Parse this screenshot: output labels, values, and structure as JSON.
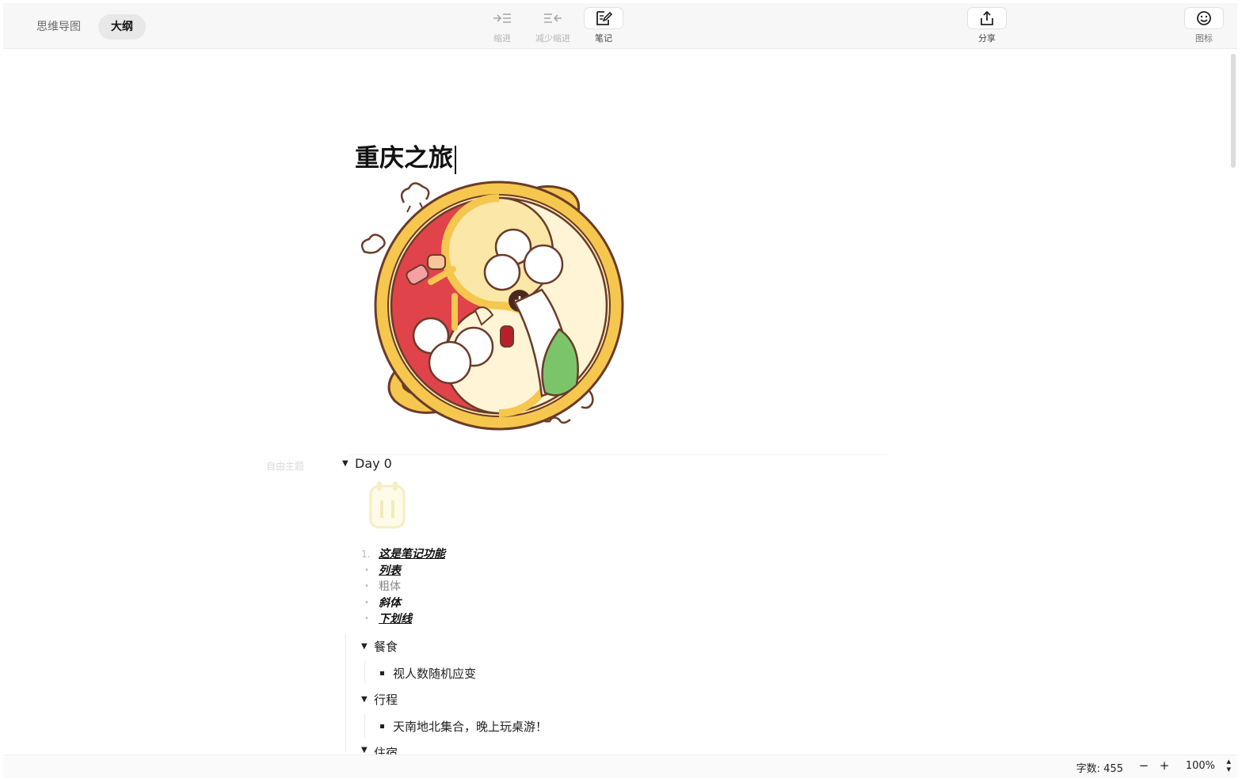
{
  "view": {
    "mindmap_label": "思维导图",
    "outline_label": "大纲"
  },
  "toolbar": {
    "indent": {
      "label": "缩进",
      "icon": "indent-icon"
    },
    "outdent": {
      "label": "减少缩进",
      "icon": "outdent-icon"
    },
    "notes": {
      "label": "笔记",
      "icon": "note-edit-icon"
    },
    "share": {
      "label": "分享",
      "icon": "share-icon"
    },
    "icon": {
      "label": "图标",
      "icon": "emoji-icon"
    }
  },
  "document": {
    "title": "重庆之旅",
    "free_topic_label": "自由主题",
    "day0": {
      "label": "Day 0",
      "note": {
        "items": [
          {
            "marker": "1.",
            "text": "这是笔记功能"
          },
          {
            "marker": "•",
            "text": "列表"
          },
          {
            "marker": "•",
            "text": "粗体"
          },
          {
            "marker": "•",
            "text": "斜体"
          },
          {
            "marker": "•",
            "text": "下划线"
          }
        ]
      },
      "children": [
        {
          "label": "餐食",
          "children": [
            "视人数随机应变"
          ]
        },
        {
          "label": "行程",
          "children": [
            "天南地北集合，晚上玩桌游！"
          ]
        },
        {
          "label": "住宿"
        }
      ]
    }
  },
  "status": {
    "word_count": "字数: 455",
    "zoom": "100%",
    "zoom_out": "−",
    "zoom_in": "+"
  },
  "colors": {
    "accent": "#111111",
    "toolbar_bg": "#f7f7f7",
    "pot_rim": "#f5c74e",
    "soup_red": "#e0434a",
    "soup_white": "#fff4d6"
  }
}
